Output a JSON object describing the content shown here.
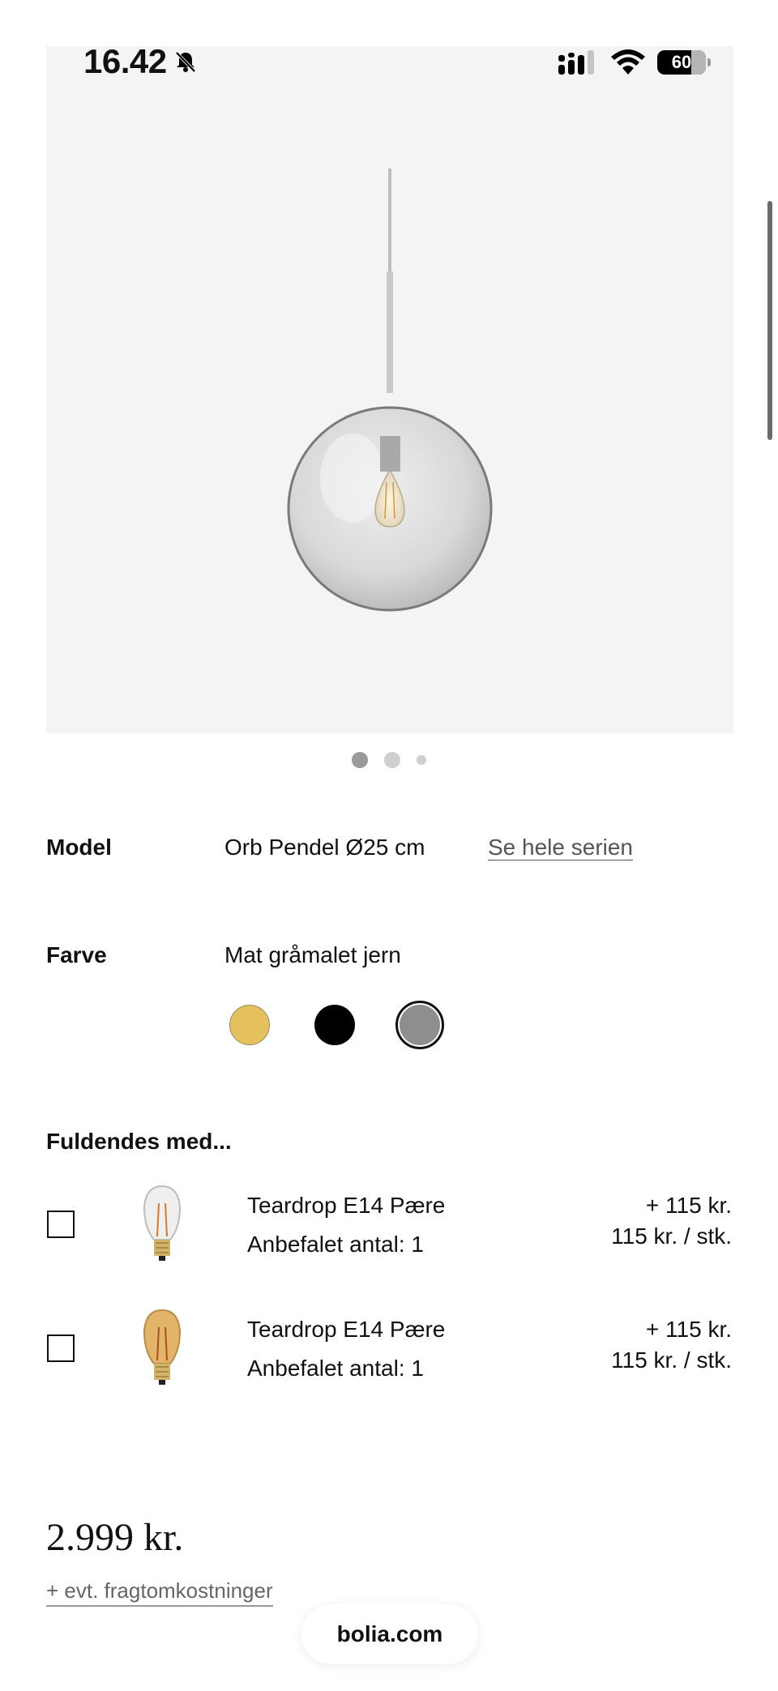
{
  "status_bar": {
    "time": "16.42",
    "battery": "60"
  },
  "gallery": {
    "dots": 3,
    "active_index": 0
  },
  "model": {
    "label": "Model",
    "value": "Orb Pendel Ø25 cm",
    "link": "Se hele serien"
  },
  "color": {
    "label": "Farve",
    "value": "Mat gråmalet jern",
    "swatches": [
      {
        "name": "gold",
        "hex": "#e4c15c"
      },
      {
        "name": "black",
        "hex": "#000000"
      },
      {
        "name": "grey",
        "hex": "#8e8e8e",
        "selected": true
      }
    ]
  },
  "addons": {
    "heading": "Fuldendes med...",
    "items": [
      {
        "title": "Teardrop E14 Pære",
        "subtitle": "Anbefalet antal: 1",
        "price": "+ 115 kr.",
        "unit_price": "115 kr. / stk.",
        "bulb_color": "clear"
      },
      {
        "title": "Teardrop E14 Pære",
        "subtitle": "Anbefalet antal: 1",
        "price": "+ 115 kr.",
        "unit_price": "115 kr. / stk.",
        "bulb_color": "amber"
      }
    ]
  },
  "price": {
    "amount": "2.999 kr.",
    "freight": "+ evt. fragtomkostninger"
  },
  "browser": {
    "url": "bolia.com"
  }
}
